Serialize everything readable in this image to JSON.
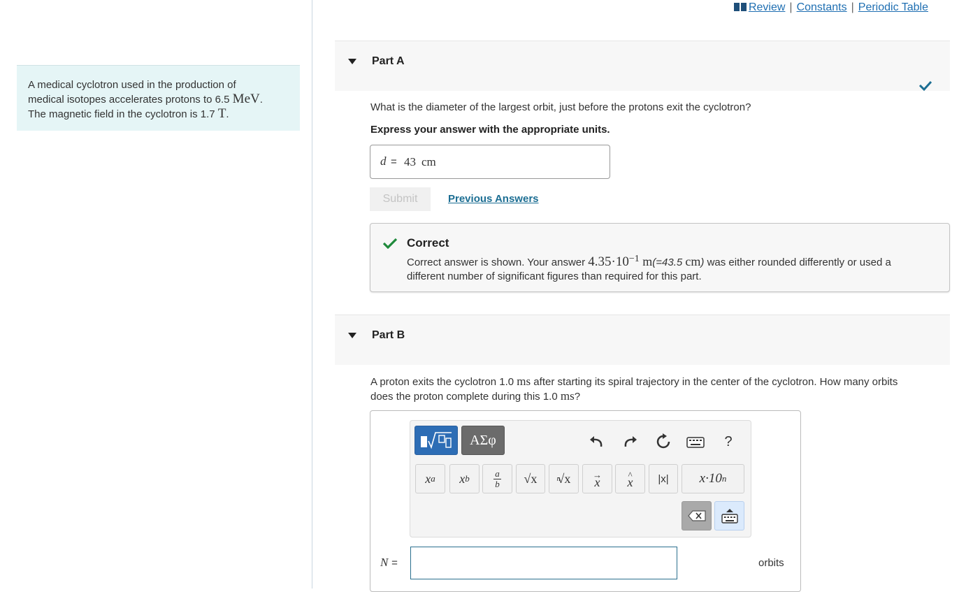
{
  "top_links": {
    "review": "Review",
    "constants": "Constants",
    "periodic_table": "Periodic Table",
    "separator": "|"
  },
  "problem": {
    "line1": "A medical cyclotron used in the production of",
    "line2_pre": "medical isotopes accelerates protons to 6.5 ",
    "line2_unit": "MeV",
    "line2_post": ".",
    "line3_pre": "The magnetic field in the cyclotron is 1.7 ",
    "line3_unit": "T",
    "line3_post": "."
  },
  "part_a": {
    "title": "Part A",
    "question": "What is the diameter of the largest orbit, just before the protons exit the cyclotron?",
    "instruction": "Express your answer with the appropriate units.",
    "answer_var": "d",
    "answer_eq": "=",
    "answer_value": "43",
    "answer_unit": "cm",
    "submit_label": "Submit",
    "previous_answers_label": "Previous Answers",
    "feedback_title": "Correct",
    "feedback_pre": "Correct answer is shown. Your answer ",
    "feedback_mantissa": "4.35·10",
    "feedback_exp": "−1",
    "feedback_unit": " m",
    "feedback_alt_open": "(=43.5 ",
    "feedback_alt_unit": "cm",
    "feedback_alt_close": ")",
    "feedback_post": " was either rounded differently or used a",
    "feedback_line2": "different number of significant figures than required for this part.",
    "success_color": "#1f8a3c"
  },
  "part_b": {
    "title": "Part B",
    "q_pre": "A proton exits the cyclotron 1.0 ",
    "q_unit1": "ms",
    "q_mid": " after starting its spiral trajectory in the center of the cyclotron. How many orbits",
    "q_line2_pre": "does the proton complete during this 1.0 ",
    "q_unit2": "ms",
    "q_line2_post": "?",
    "templates_label": "√",
    "greek_label": "ΑΣφ",
    "help_label": "?",
    "buttons": {
      "superscript": "x",
      "superscript_sup": "a",
      "subscript": "x",
      "subscript_sub": "b",
      "fraction_num": "a",
      "fraction_den": "b",
      "sqrt": "√x",
      "nth_root_n": "n",
      "nth_root": "√x",
      "vector": "x",
      "unit_vector": "x",
      "abs": "|x|",
      "sci_notation": "x·10",
      "sci_notation_sup": "n"
    },
    "answer_var": "N",
    "answer_eq": "=",
    "answer_value": "",
    "units_label": "orbits",
    "accent_blue": "#2d6db5"
  }
}
